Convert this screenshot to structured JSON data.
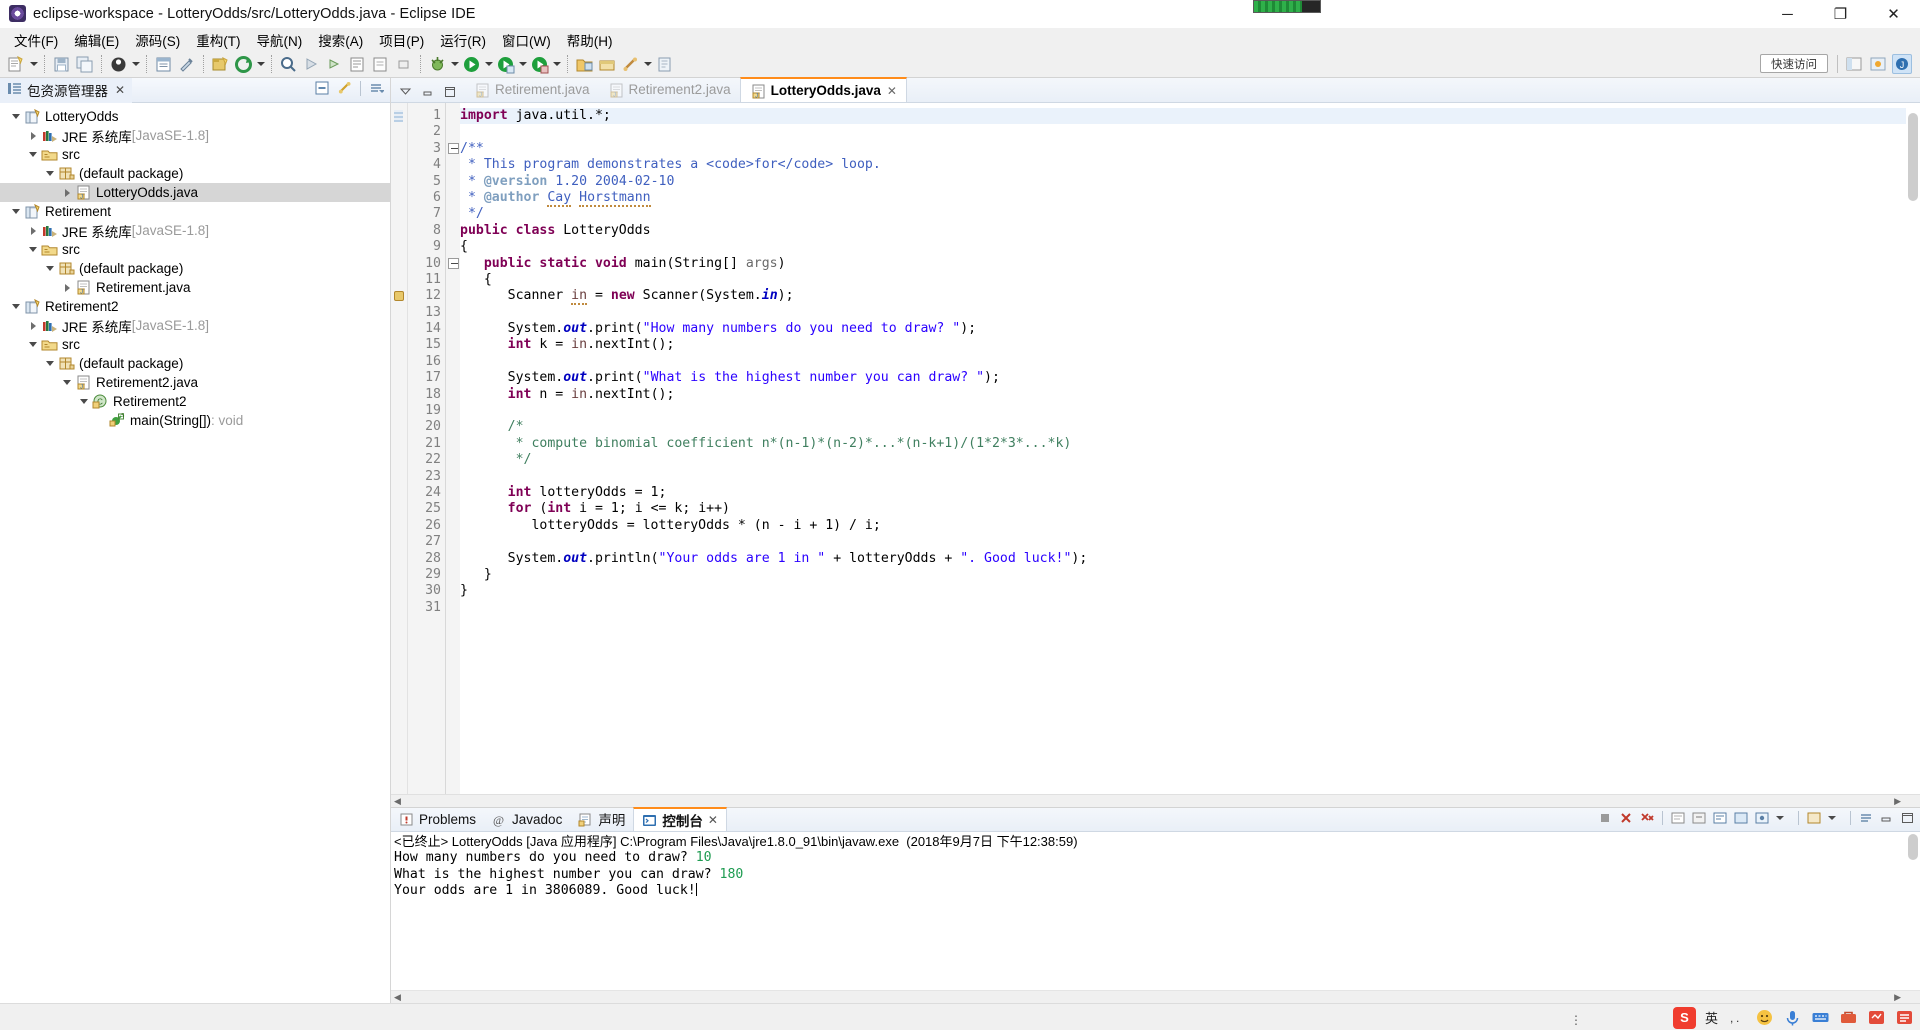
{
  "window": {
    "title": "eclipse-workspace - LotteryOdds/src/LotteryOdds.java - Eclipse IDE",
    "minimize": "─",
    "maximize": "❐",
    "close": "✕"
  },
  "menu": [
    {
      "label": "文件(F)"
    },
    {
      "label": "编辑(E)"
    },
    {
      "label": "源码(S)"
    },
    {
      "label": "重构(T)"
    },
    {
      "label": "导航(N)"
    },
    {
      "label": "搜索(A)"
    },
    {
      "label": "项目(P)"
    },
    {
      "label": "运行(R)"
    },
    {
      "label": "窗口(W)"
    },
    {
      "label": "帮助(H)"
    }
  ],
  "toolbar": {
    "quick_access": "快速访问"
  },
  "explorer": {
    "tab_label": "包资源管理器",
    "close_label": "✕",
    "tree": [
      {
        "label": "LotteryOdds",
        "indent": 0,
        "twisty": "down",
        "icon": "project-icon",
        "selected": false,
        "dim": ""
      },
      {
        "label": "JRE 系统库",
        "indent": 1,
        "twisty": "right",
        "icon": "library-icon",
        "selected": false,
        "dim": "[JavaSE-1.8]"
      },
      {
        "label": "src",
        "indent": 1,
        "twisty": "down",
        "icon": "source-folder-icon",
        "selected": false,
        "dim": ""
      },
      {
        "label": "(default package)",
        "indent": 2,
        "twisty": "down",
        "icon": "package-icon",
        "selected": false,
        "dim": ""
      },
      {
        "label": "LotteryOdds.java",
        "indent": 3,
        "twisty": "right",
        "icon": "java-file-icon",
        "selected": true,
        "dim": ""
      },
      {
        "label": "Retirement",
        "indent": 0,
        "twisty": "down",
        "icon": "project-icon",
        "selected": false,
        "dim": ""
      },
      {
        "label": "JRE 系统库",
        "indent": 1,
        "twisty": "right",
        "icon": "library-icon",
        "selected": false,
        "dim": "[JavaSE-1.8]"
      },
      {
        "label": "src",
        "indent": 1,
        "twisty": "down",
        "icon": "source-folder-icon",
        "selected": false,
        "dim": ""
      },
      {
        "label": "(default package)",
        "indent": 2,
        "twisty": "down",
        "icon": "package-icon",
        "selected": false,
        "dim": ""
      },
      {
        "label": "Retirement.java",
        "indent": 3,
        "twisty": "right",
        "icon": "java-file-icon",
        "selected": false,
        "dim": ""
      },
      {
        "label": "Retirement2",
        "indent": 0,
        "twisty": "down",
        "icon": "project-icon",
        "selected": false,
        "dim": ""
      },
      {
        "label": "JRE 系统库",
        "indent": 1,
        "twisty": "right",
        "icon": "library-icon",
        "selected": false,
        "dim": "[JavaSE-1.8]"
      },
      {
        "label": "src",
        "indent": 1,
        "twisty": "down",
        "icon": "source-folder-icon",
        "selected": false,
        "dim": ""
      },
      {
        "label": "(default package)",
        "indent": 2,
        "twisty": "down",
        "icon": "package-icon",
        "selected": false,
        "dim": ""
      },
      {
        "label": "Retirement2.java",
        "indent": 3,
        "twisty": "down",
        "icon": "java-file-icon",
        "selected": false,
        "dim": ""
      },
      {
        "label": "Retirement2",
        "indent": 4,
        "twisty": "down",
        "icon": "class-icon",
        "selected": false,
        "dim": ""
      },
      {
        "label": "main(String[])",
        "indent": 5,
        "twisty": "none",
        "icon": "method-icon",
        "selected": false,
        "dim": ": void"
      }
    ]
  },
  "editor": {
    "tabs": [
      {
        "label": "Retirement.java",
        "active": false,
        "close": ""
      },
      {
        "label": "Retirement2.java",
        "active": false,
        "close": ""
      },
      {
        "label": "LotteryOdds.java",
        "active": true,
        "close": "✕"
      }
    ],
    "code_lines": [
      {
        "n": 1,
        "fold": "",
        "marker": "",
        "hl": true,
        "tokens": [
          {
            "t": "import",
            "c": "kw"
          },
          {
            "t": " java.util.*;",
            "c": ""
          }
        ]
      },
      {
        "n": 2,
        "fold": "",
        "marker": "",
        "hl": false,
        "tokens": []
      },
      {
        "n": 3,
        "fold": "-",
        "marker": "",
        "hl": false,
        "tokens": [
          {
            "t": "/**",
            "c": "jdoc"
          }
        ]
      },
      {
        "n": 4,
        "fold": "",
        "marker": "",
        "hl": false,
        "tokens": [
          {
            "t": " * This program demonstrates a <code>for</code> loop.",
            "c": "jdoc"
          }
        ]
      },
      {
        "n": 5,
        "fold": "",
        "marker": "",
        "hl": false,
        "tokens": [
          {
            "t": " * ",
            "c": "jdoc"
          },
          {
            "t": "@version",
            "c": "jtag"
          },
          {
            "t": " 1.20 2004-02-10",
            "c": "jdoc"
          }
        ]
      },
      {
        "n": 6,
        "fold": "",
        "marker": "",
        "hl": false,
        "tokens": [
          {
            "t": " * ",
            "c": "jdoc"
          },
          {
            "t": "@author",
            "c": "jtag"
          },
          {
            "t": " ",
            "c": "jdoc"
          },
          {
            "t": "Cay",
            "c": "jdoc spell"
          },
          {
            "t": " ",
            "c": "jdoc"
          },
          {
            "t": "Horstmann",
            "c": "jdoc spell"
          }
        ]
      },
      {
        "n": 7,
        "fold": "",
        "marker": "",
        "hl": false,
        "tokens": [
          {
            "t": " */",
            "c": "jdoc"
          }
        ]
      },
      {
        "n": 8,
        "fold": "",
        "marker": "",
        "hl": false,
        "tokens": [
          {
            "t": "public class",
            "c": "kw"
          },
          {
            "t": " LotteryOdds",
            "c": ""
          }
        ]
      },
      {
        "n": 9,
        "fold": "",
        "marker": "",
        "hl": false,
        "tokens": [
          {
            "t": "{",
            "c": ""
          }
        ]
      },
      {
        "n": 10,
        "fold": "-",
        "marker": "",
        "hl": false,
        "tokens": [
          {
            "t": "   ",
            "c": ""
          },
          {
            "t": "public static void",
            "c": "kw"
          },
          {
            "t": " main(String[] ",
            "c": ""
          },
          {
            "t": "args",
            "c": "par"
          },
          {
            "t": ")",
            "c": ""
          }
        ]
      },
      {
        "n": 11,
        "fold": "",
        "marker": "",
        "hl": false,
        "tokens": [
          {
            "t": "   {",
            "c": ""
          }
        ]
      },
      {
        "n": 12,
        "fold": "",
        "marker": "warn",
        "hl": false,
        "tokens": [
          {
            "t": "      Scanner ",
            "c": ""
          },
          {
            "t": "in",
            "c": "loc spell"
          },
          {
            "t": " = ",
            "c": ""
          },
          {
            "t": "new",
            "c": "kw"
          },
          {
            "t": " Scanner(System.",
            "c": ""
          },
          {
            "t": "in",
            "c": "fld"
          },
          {
            "t": ");",
            "c": ""
          }
        ]
      },
      {
        "n": 13,
        "fold": "",
        "marker": "",
        "hl": false,
        "tokens": []
      },
      {
        "n": 14,
        "fold": "",
        "marker": "",
        "hl": false,
        "tokens": [
          {
            "t": "      System.",
            "c": ""
          },
          {
            "t": "out",
            "c": "fld"
          },
          {
            "t": ".print(",
            "c": ""
          },
          {
            "t": "\"How many numbers do you need to draw? \"",
            "c": "str"
          },
          {
            "t": ");",
            "c": ""
          }
        ]
      },
      {
        "n": 15,
        "fold": "",
        "marker": "",
        "hl": false,
        "tokens": [
          {
            "t": "      ",
            "c": ""
          },
          {
            "t": "int",
            "c": "kw"
          },
          {
            "t": " k = ",
            "c": ""
          },
          {
            "t": "in",
            "c": "loc"
          },
          {
            "t": ".nextInt();",
            "c": ""
          }
        ]
      },
      {
        "n": 16,
        "fold": "",
        "marker": "",
        "hl": false,
        "tokens": []
      },
      {
        "n": 17,
        "fold": "",
        "marker": "",
        "hl": false,
        "tokens": [
          {
            "t": "      System.",
            "c": ""
          },
          {
            "t": "out",
            "c": "fld"
          },
          {
            "t": ".print(",
            "c": ""
          },
          {
            "t": "\"What is the highest number you can draw? \"",
            "c": "str"
          },
          {
            "t": ");",
            "c": ""
          }
        ]
      },
      {
        "n": 18,
        "fold": "",
        "marker": "",
        "hl": false,
        "tokens": [
          {
            "t": "      ",
            "c": ""
          },
          {
            "t": "int",
            "c": "kw"
          },
          {
            "t": " n = ",
            "c": ""
          },
          {
            "t": "in",
            "c": "loc"
          },
          {
            "t": ".nextInt();",
            "c": ""
          }
        ]
      },
      {
        "n": 19,
        "fold": "",
        "marker": "",
        "hl": false,
        "tokens": []
      },
      {
        "n": 20,
        "fold": "",
        "marker": "",
        "hl": false,
        "tokens": [
          {
            "t": "      /*",
            "c": "cmt"
          }
        ]
      },
      {
        "n": 21,
        "fold": "",
        "marker": "",
        "hl": false,
        "tokens": [
          {
            "t": "       * compute binomial coefficient n*(n-1)*(n-2)*...*(n-k+1)/(1*2*3*...*k)",
            "c": "cmt"
          }
        ]
      },
      {
        "n": 22,
        "fold": "",
        "marker": "",
        "hl": false,
        "tokens": [
          {
            "t": "       */",
            "c": "cmt"
          }
        ]
      },
      {
        "n": 23,
        "fold": "",
        "marker": "",
        "hl": false,
        "tokens": []
      },
      {
        "n": 24,
        "fold": "",
        "marker": "",
        "hl": false,
        "tokens": [
          {
            "t": "      ",
            "c": ""
          },
          {
            "t": "int",
            "c": "kw"
          },
          {
            "t": " lotteryOdds = 1;",
            "c": ""
          }
        ]
      },
      {
        "n": 25,
        "fold": "",
        "marker": "",
        "hl": false,
        "tokens": [
          {
            "t": "      ",
            "c": ""
          },
          {
            "t": "for",
            "c": "kw"
          },
          {
            "t": " (",
            "c": ""
          },
          {
            "t": "int",
            "c": "kw"
          },
          {
            "t": " i = 1; i <= k; i++)",
            "c": ""
          }
        ]
      },
      {
        "n": 26,
        "fold": "",
        "marker": "",
        "hl": false,
        "tokens": [
          {
            "t": "         lotteryOdds = lotteryOdds * (n - i + 1) / i;",
            "c": ""
          }
        ]
      },
      {
        "n": 27,
        "fold": "",
        "marker": "",
        "hl": false,
        "tokens": []
      },
      {
        "n": 28,
        "fold": "",
        "marker": "",
        "hl": false,
        "tokens": [
          {
            "t": "      System.",
            "c": ""
          },
          {
            "t": "out",
            "c": "fld"
          },
          {
            "t": ".println(",
            "c": ""
          },
          {
            "t": "\"Your odds are 1 in \"",
            "c": "str"
          },
          {
            "t": " + lotteryOdds + ",
            "c": ""
          },
          {
            "t": "\". Good luck!\"",
            "c": "str"
          },
          {
            "t": ");",
            "c": ""
          }
        ]
      },
      {
        "n": 29,
        "fold": "",
        "marker": "",
        "hl": false,
        "tokens": [
          {
            "t": "   }",
            "c": ""
          }
        ]
      },
      {
        "n": 30,
        "fold": "",
        "marker": "",
        "hl": false,
        "tokens": [
          {
            "t": "}",
            "c": ""
          }
        ]
      },
      {
        "n": 31,
        "fold": "",
        "marker": "",
        "hl": false,
        "tokens": []
      }
    ]
  },
  "bottom": {
    "tabs": [
      {
        "label": "Problems",
        "icon": "problems-icon",
        "active": false,
        "close": ""
      },
      {
        "label": "Javadoc",
        "icon": "javadoc-icon",
        "active": false,
        "close": ""
      },
      {
        "label": "声明",
        "icon": "declaration-icon",
        "active": false,
        "close": ""
      },
      {
        "label": "控制台",
        "icon": "console-icon",
        "active": true,
        "close": "✕"
      }
    ],
    "console": {
      "header": "<已终止> LotteryOdds [Java 应用程序] C:\\Program Files\\Java\\jre1.8.0_91\\bin\\javaw.exe  (2018年9月7日 下午12:38:59)",
      "lines": [
        {
          "prompt": "How many numbers do you need to draw? ",
          "input": "10"
        },
        {
          "prompt": "What is the highest number you can draw? ",
          "input": "180"
        },
        {
          "prompt": "Your odds are 1 in 3806089. Good luck!",
          "input": ""
        }
      ]
    }
  },
  "tray": {
    "ime_label": "英",
    "sogou_mark": "S"
  },
  "colors": {
    "accent_orange": "#ff8c1a",
    "keyword": "#7f0055",
    "string": "#2a00ff",
    "comment": "#3f7f5f",
    "javadoc": "#3f5fbf",
    "console_input": "#1f9c52",
    "selection": "#d6d6d6"
  }
}
